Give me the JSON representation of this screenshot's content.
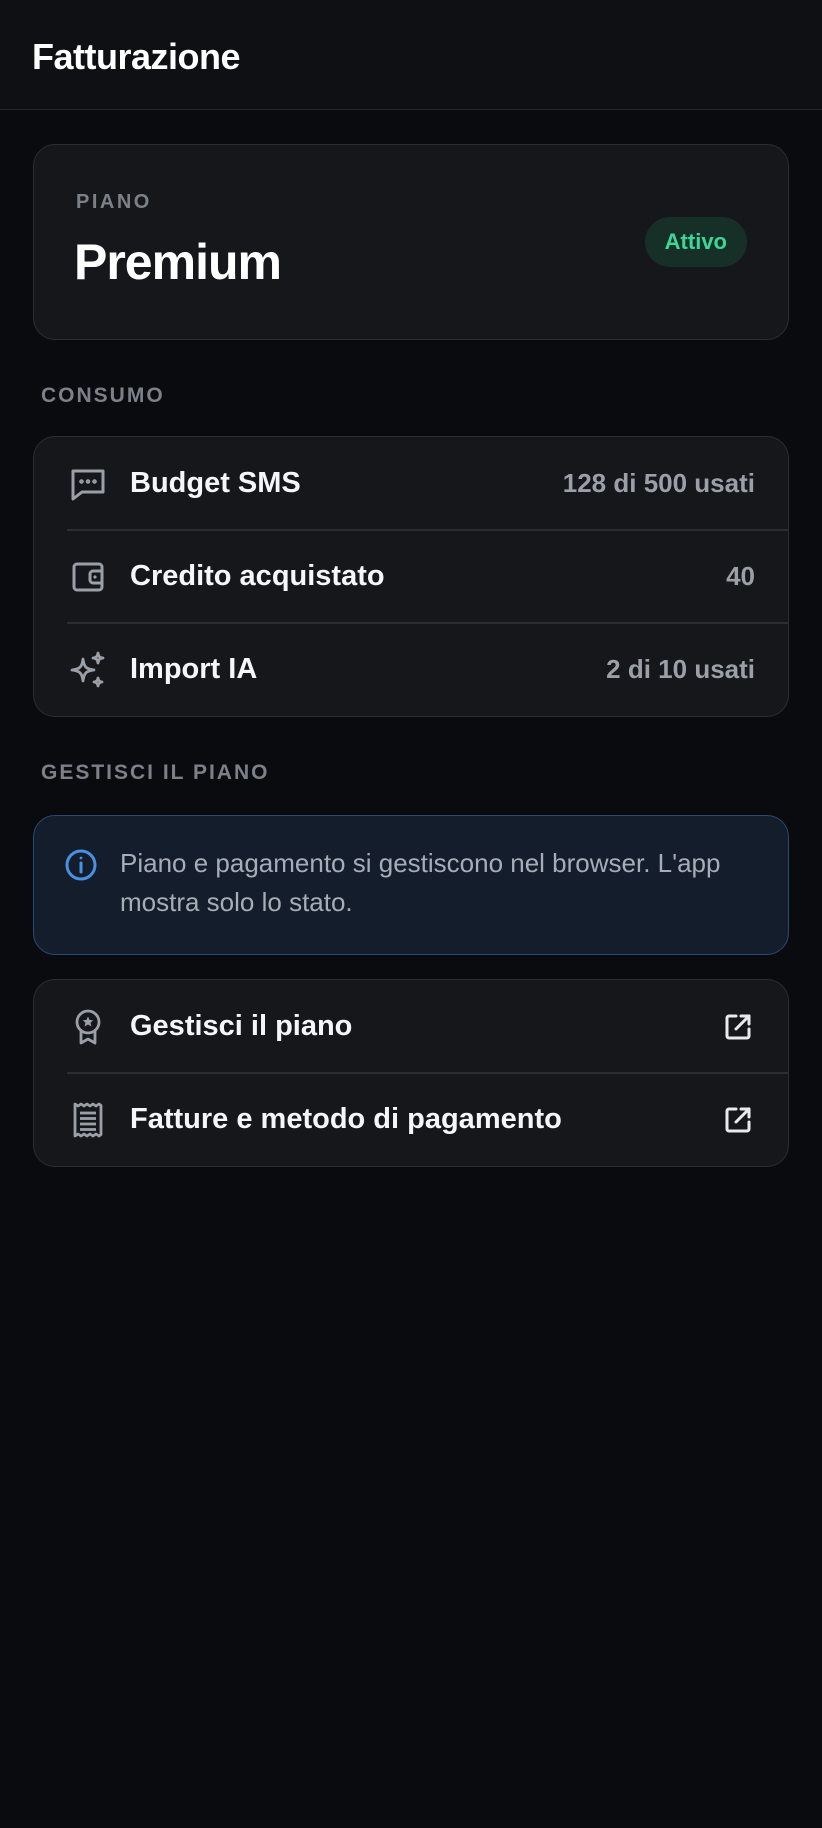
{
  "header": {
    "title": "Fatturazione"
  },
  "plan": {
    "label": "PIANO",
    "name": "Premium",
    "status": "Attivo"
  },
  "usage": {
    "section_label": "CONSUMO",
    "items": [
      {
        "icon": "message-icon",
        "label": "Budget SMS",
        "value": "128 di 500 usati"
      },
      {
        "icon": "wallet-icon",
        "label": "Credito acquistato",
        "value": "40"
      },
      {
        "icon": "sparkles-icon",
        "label": "Import IA",
        "value": "2 di 10 usati"
      }
    ]
  },
  "manage": {
    "section_label": "GESTISCI IL PIANO",
    "info_text": "Piano e pagamento si gestiscono nel browser. L'app mostra solo lo stato.",
    "actions": [
      {
        "icon": "award-icon",
        "label": "Gestisci il piano",
        "trailing_icon": "external-link-icon"
      },
      {
        "icon": "receipt-icon",
        "label": "Fatture e metodo di pagamento",
        "trailing_icon": "external-link-icon"
      }
    ]
  },
  "colors": {
    "background": "#0a0b0e",
    "card": "#15171b",
    "status_green": "#3ed597",
    "info_blue": "#4a90e2"
  }
}
